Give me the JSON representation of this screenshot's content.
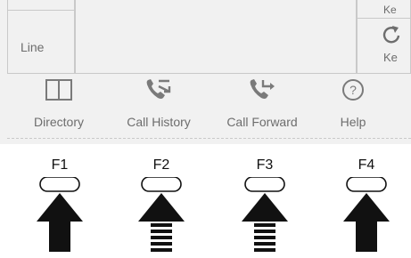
{
  "screen": {
    "line_label": "Line",
    "right_top_label": "Ke",
    "right_cell_label": "Ke"
  },
  "softkeys": [
    {
      "label": "Directory",
      "icon": "book-icon"
    },
    {
      "label": "Call History",
      "icon": "call-history-icon"
    },
    {
      "label": "Call Forward",
      "icon": "call-forward-icon"
    },
    {
      "label": "Help",
      "icon": "help-icon"
    }
  ],
  "function_keys": [
    {
      "label": "F1"
    },
    {
      "label": "F2"
    },
    {
      "label": "F3"
    },
    {
      "label": "F4"
    }
  ],
  "colors": {
    "screen_bg": "#f1f1f1",
    "icon_gray": "#7a7a7a",
    "text_gray": "#6d6d6d",
    "arrow": "#111111"
  }
}
